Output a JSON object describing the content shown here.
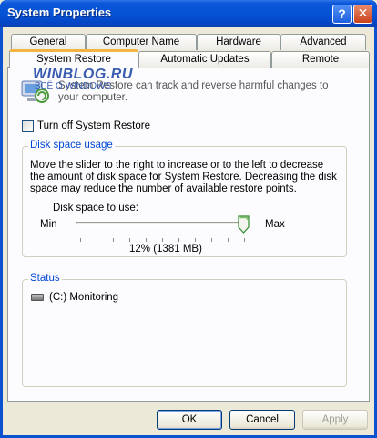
{
  "window": {
    "title": "System Properties",
    "help_glyph": "?",
    "close_glyph": "✕"
  },
  "tabs_row1": [
    "General",
    "Computer Name",
    "Hardware",
    "Advanced"
  ],
  "tabs_row2": [
    "System Restore",
    "Automatic Updates",
    "Remote"
  ],
  "watermark": {
    "line1": "WINBLOG.RU",
    "line2": "ВСЁ О WINDOWS"
  },
  "intro": "System Restore can track and reverse harmful changes to your computer.",
  "checkbox": {
    "label": "Turn off System Restore",
    "checked": false
  },
  "disk_space_group": {
    "legend": "Disk space usage",
    "description": "Move the slider to the right to increase or to the left to decrease the amount of disk space for System Restore. Decreasing the disk space may reduce the number of available restore points.",
    "slider_label": "Disk space to use:",
    "min_label": "Min",
    "max_label": "Max",
    "value_text": "12% (1381 MB)",
    "slider_level_fraction": 0.97
  },
  "status_group": {
    "legend": "Status",
    "items": [
      {
        "drive": "(C:) Monitoring",
        "icon": "drive-icon"
      }
    ]
  },
  "buttons": {
    "ok": "OK",
    "cancel": "Cancel",
    "apply": "Apply",
    "apply_enabled": false
  },
  "colors": {
    "title_bar": "#0653d6",
    "accent_tab": "#f2b543",
    "group_legend": "#0046d5",
    "face": "#ece9d8"
  }
}
